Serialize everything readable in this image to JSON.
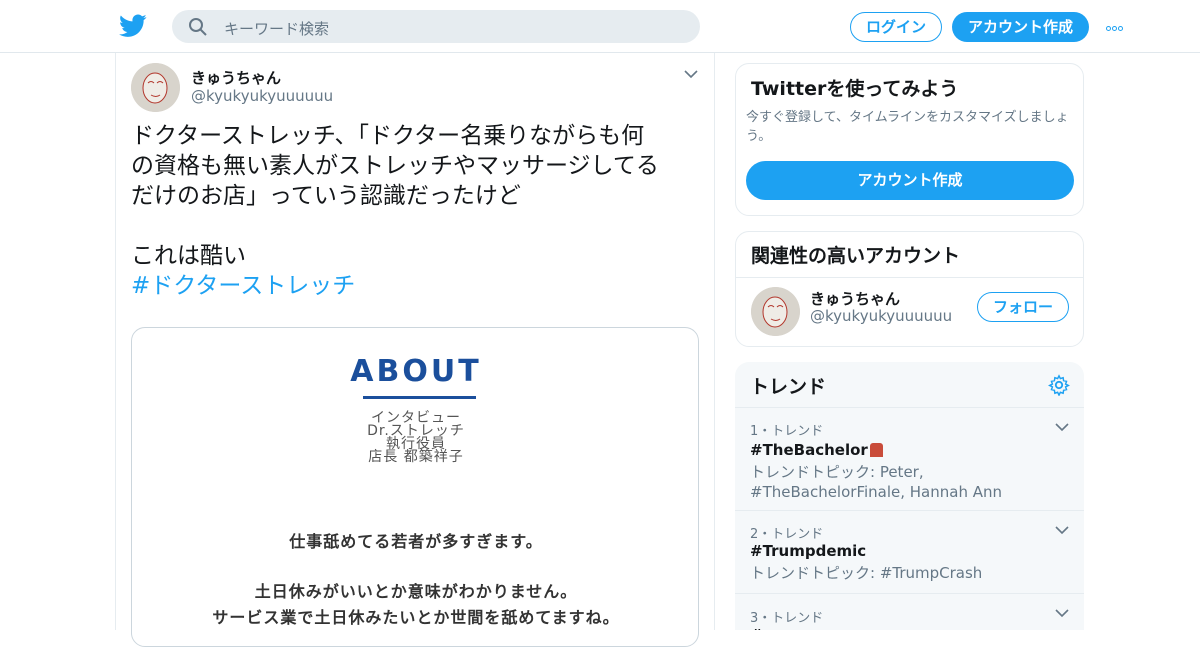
{
  "header": {
    "search_placeholder": "キーワード検索",
    "login_label": "ログイン",
    "signup_label": "アカウント作成"
  },
  "tweet": {
    "name": "きゅうちゃん",
    "handle": "@kyukyukyuuuuuu",
    "text": "ドクターストレッチ、「ドクター名乗りながらも何\nの資格も無い素人がストレッチやマッサージしてる\nだけのお店」っていう認識だったけど\n\nこれは酷い",
    "hashtag": "#ドクターストレッチ",
    "media": {
      "heading": "ABOUT",
      "lines": [
        "インタビュー",
        "Dr.ストレッチ",
        "執行役員",
        "店長 都築祥子"
      ],
      "quote1": "仕事舐めてる若者が多すぎます。",
      "quote2": "土日休みがいいとか意味がわかりません。",
      "quote3": "サービス業で土日休みたいとか世間を舐めてますね。"
    }
  },
  "sidebar": {
    "join": {
      "title": "Twitterを使ってみよう",
      "desc": "今すぐ登録して、タイムラインをカスタマイズしましょう。",
      "button": "アカウント作成"
    },
    "related": {
      "title": "関連性の高いアカウント",
      "name": "きゅうちゃん",
      "handle": "@kyukyukyuuuuuu",
      "follow": "フォロー"
    },
    "trends": {
      "title": "トレンド",
      "items": [
        {
          "meta": "1・トレンド",
          "name": "#TheBachelor",
          "desc": "トレンドトピック: Peter, #TheBachelorFinale, Hannah Ann"
        },
        {
          "meta": "2・トレンド",
          "name": "#Trumpdemic",
          "desc": "トレンドトピック: #TrumpCrash"
        },
        {
          "meta": "3・トレンド",
          "name": "#",
          "desc": ""
        }
      ]
    }
  },
  "colors": {
    "accent": "#1da1f2",
    "muted": "#657786",
    "border": "#e6ecf0"
  }
}
